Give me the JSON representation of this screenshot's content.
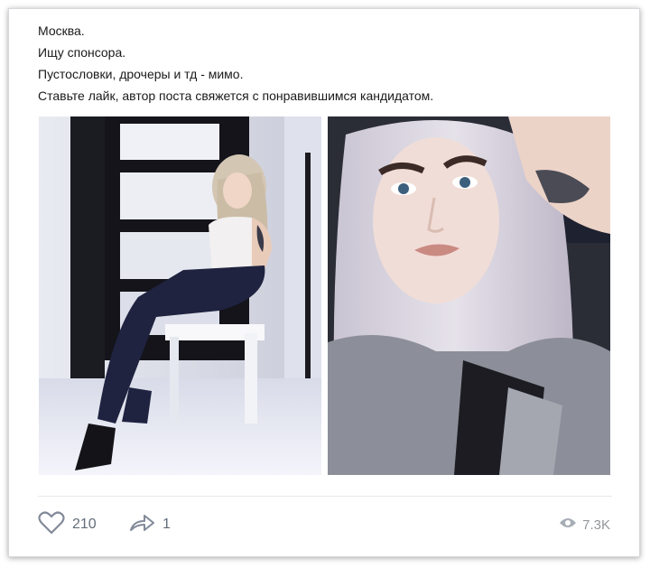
{
  "post": {
    "lines": [
      "Москва.",
      "Ищу спонсора.",
      "Пустословки, дрочеры и тд - мимо.",
      "Ставьте лайк, автор поста свяжется с понравившимся кандидатом."
    ],
    "photos": [
      {
        "icon": "photo-woman-sitting-on-chair"
      },
      {
        "icon": "photo-woman-selfie-silver-hair"
      }
    ]
  },
  "footer": {
    "likes": "210",
    "shares": "1",
    "views": "7.3K",
    "icons": {
      "like": "heart-icon",
      "share": "share-arrow-icon",
      "views": "eye-icon"
    }
  }
}
